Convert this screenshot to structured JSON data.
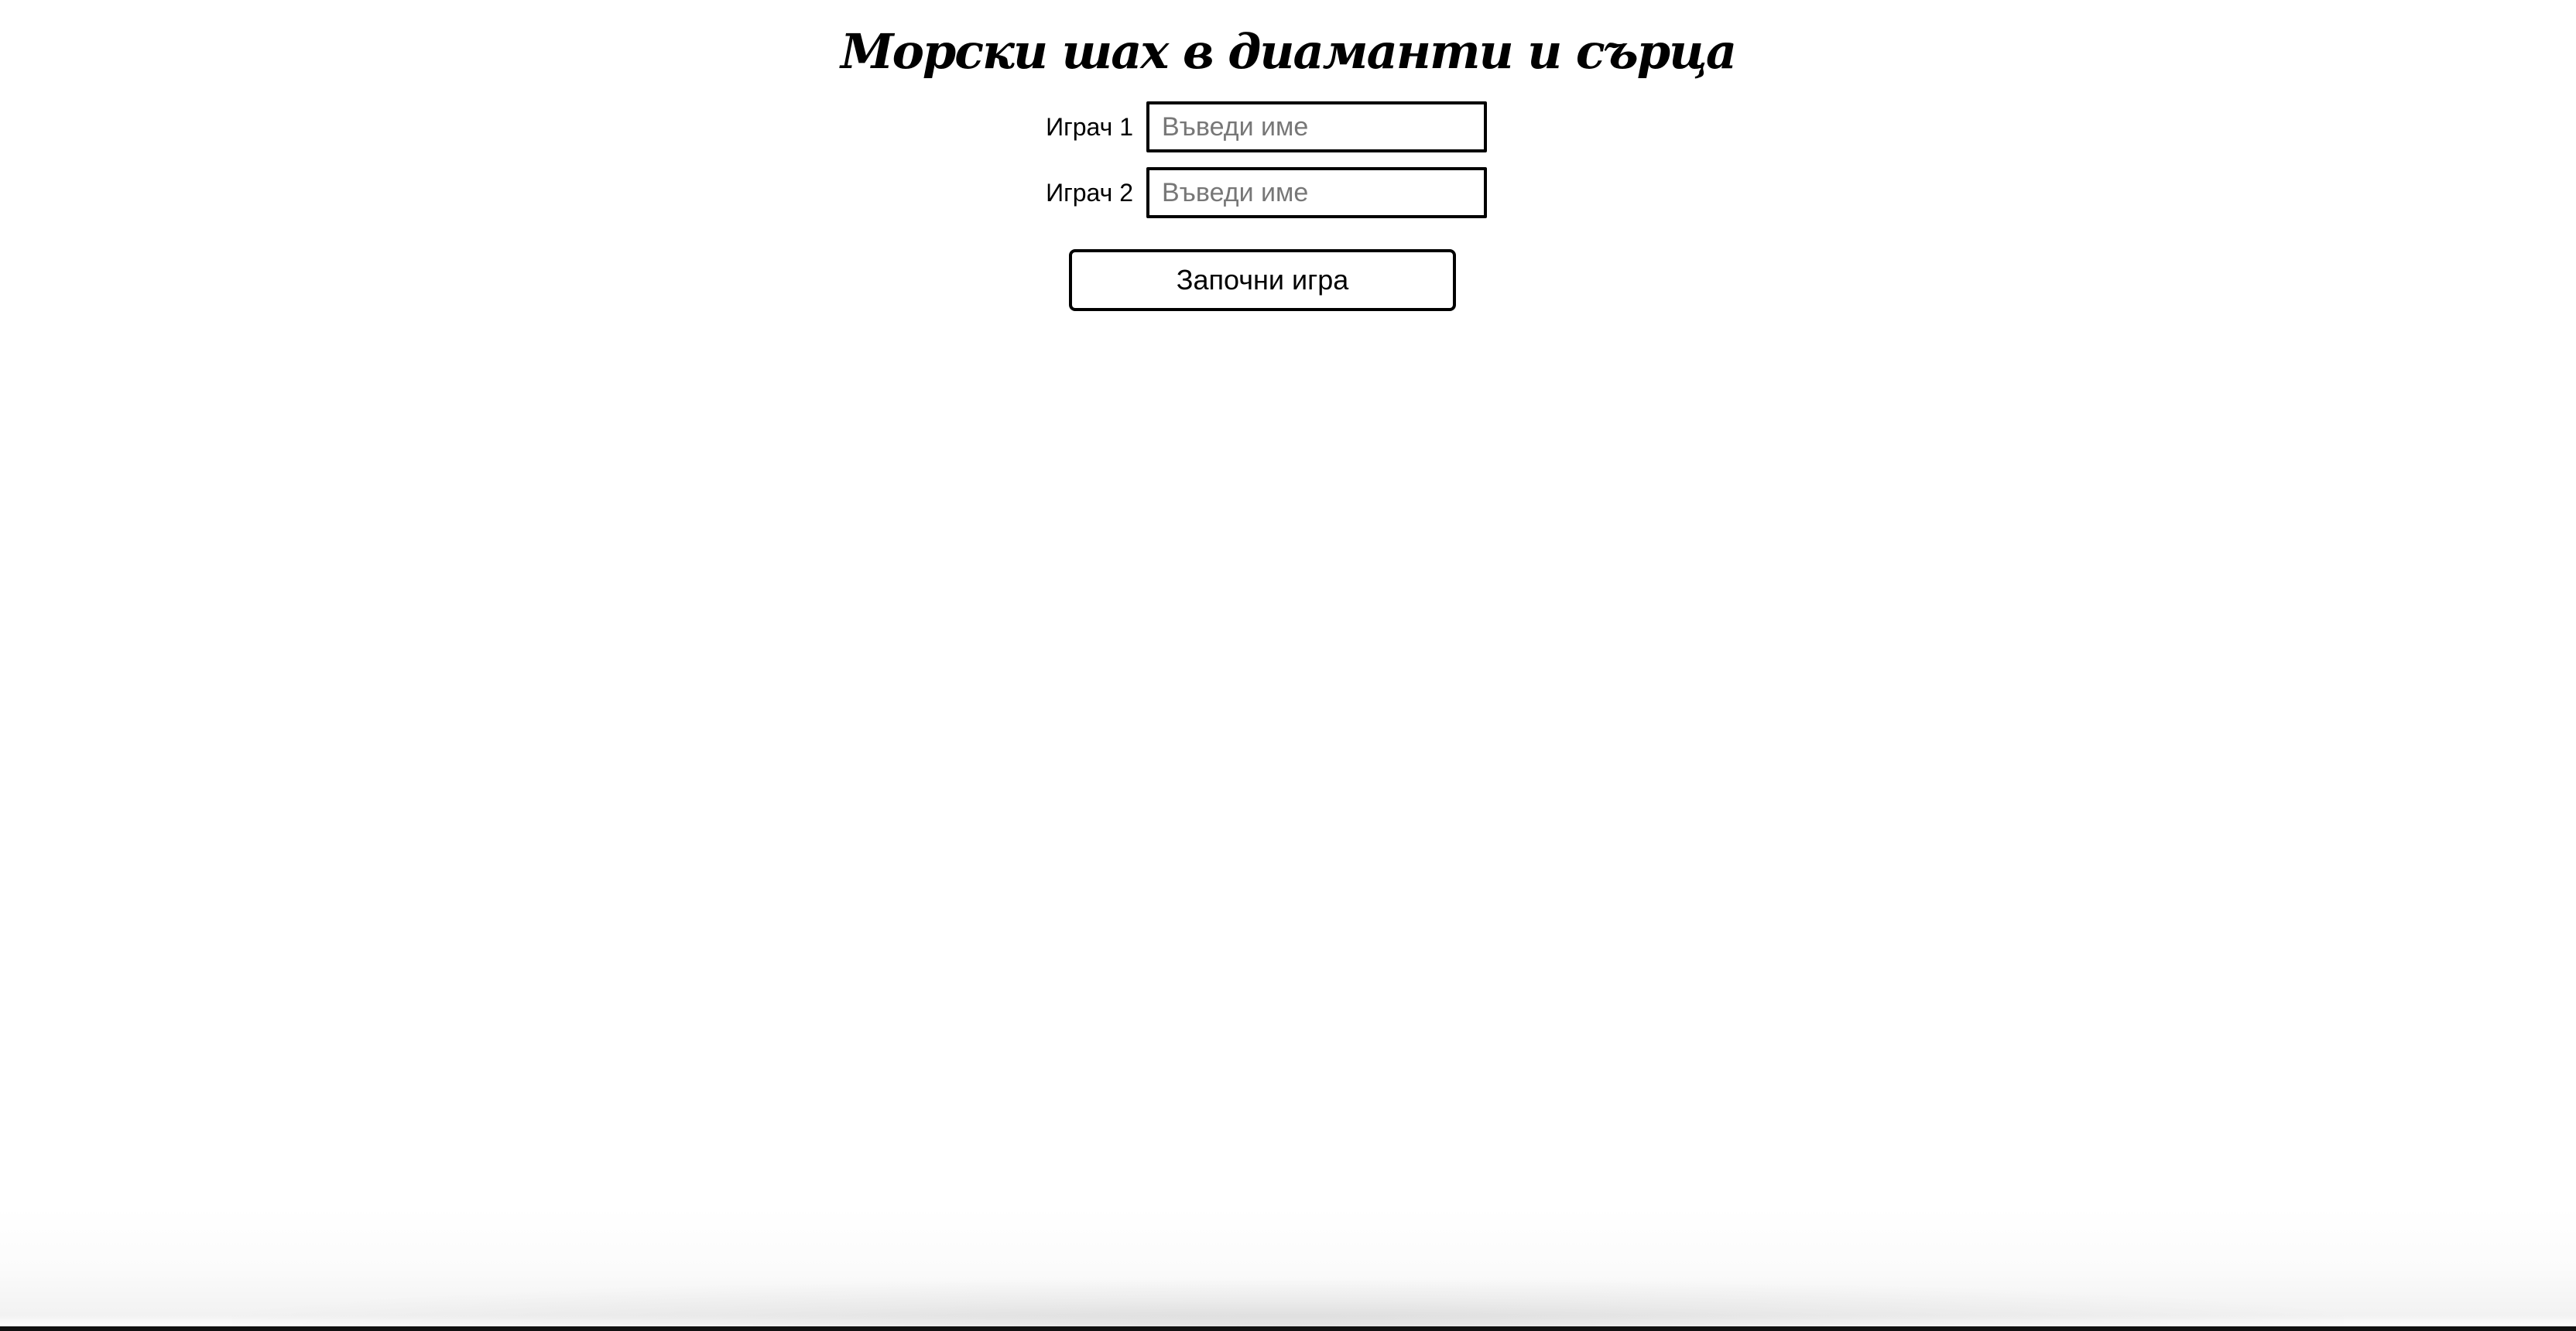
{
  "page": {
    "title": "Морски шах в диаманти и сърца"
  },
  "players": [
    {
      "label": "Играч 1",
      "placeholder": "Въведи име",
      "value": ""
    },
    {
      "label": "Играч 2",
      "placeholder": "Въведи име",
      "value": ""
    }
  ],
  "actions": {
    "start_label": "Започни игра"
  }
}
